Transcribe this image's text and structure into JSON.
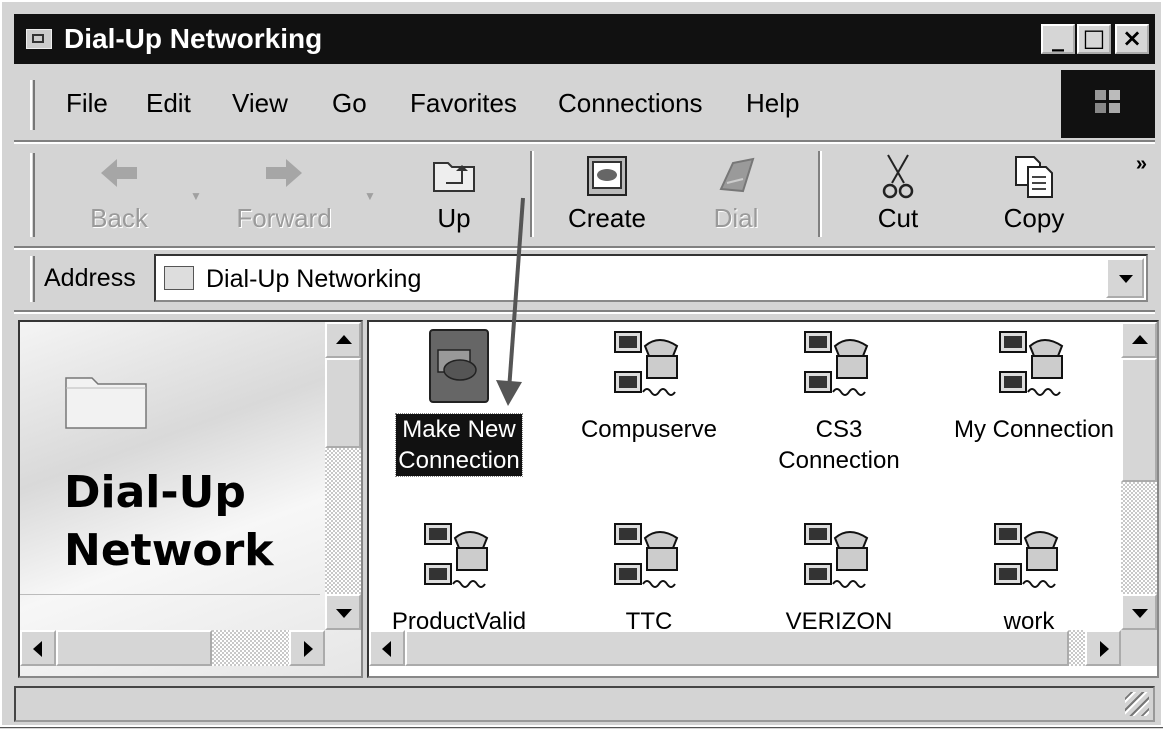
{
  "window": {
    "title": "Dial-Up Networking"
  },
  "title_buttons": [
    "_",
    "□",
    "×"
  ],
  "menu": [
    "File",
    "Edit",
    "View",
    "Go",
    "Favorites",
    "Connections",
    "Help"
  ],
  "toolbar": {
    "back": "Back",
    "forward": "Forward",
    "up": "Up",
    "create": "Create",
    "dial": "Dial",
    "cut": "Cut",
    "copy": "Copy",
    "more": "»"
  },
  "address": {
    "label": "Address",
    "value": "Dial-Up Networking"
  },
  "left_panel": {
    "title_line1": "Dial-Up",
    "title_line2": "Network"
  },
  "icons": [
    {
      "label_line1": "Make New",
      "label_line2": "Connection",
      "selected": true
    },
    {
      "label_line1": "Compuserve",
      "label_line2": ""
    },
    {
      "label_line1": "CS3",
      "label_line2": "Connection"
    },
    {
      "label_line1": "My Connection",
      "label_line2": ""
    },
    {
      "label_line1": "ProductValid",
      "label_line2": ""
    },
    {
      "label_line1": "TTC",
      "label_line2": ""
    },
    {
      "label_line1": "VERIZON",
      "label_line2": ""
    },
    {
      "label_line1": "work",
      "label_line2": ""
    }
  ],
  "status": {
    "text": ""
  }
}
